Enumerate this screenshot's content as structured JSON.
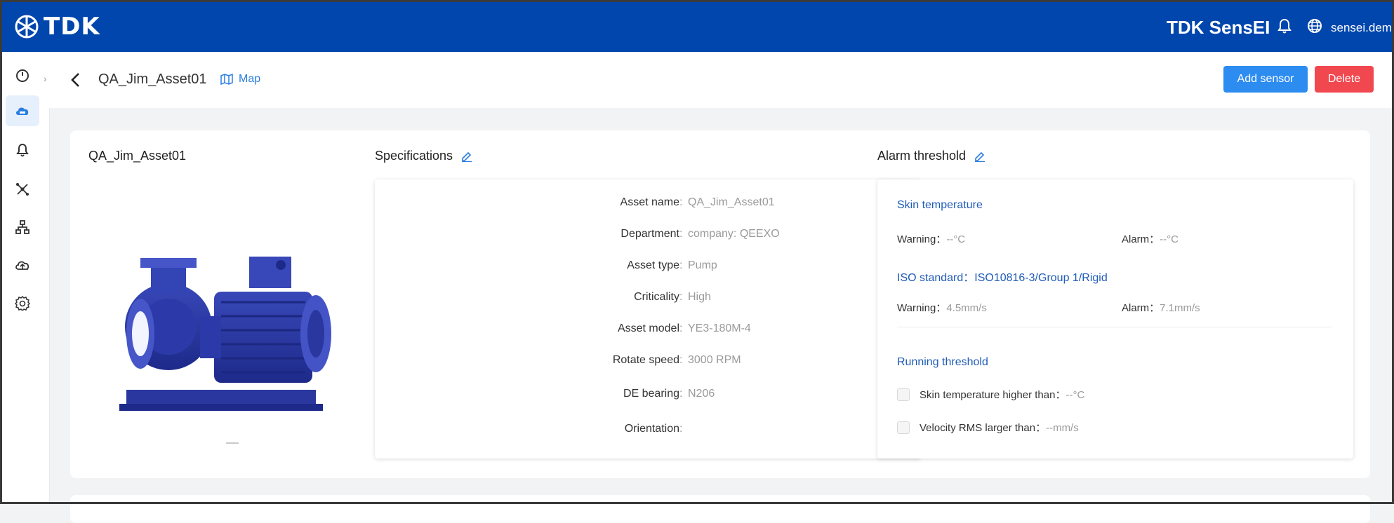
{
  "colors": {
    "brand": "#0046ad",
    "primary": "#2d8cf0",
    "danger": "#f14850",
    "link": "#2a7de1",
    "section_heading": "#1f5bb8"
  },
  "topbar": {
    "logo_text": "TDK",
    "app_title": "TDK SensEI",
    "user": "sensei.demo",
    "bell_icon": "bell-icon",
    "globe_icon": "globe-icon"
  },
  "sidebar": {
    "items": [
      {
        "icon": "dashboard-icon",
        "active": false
      },
      {
        "icon": "asset-cloud-icon",
        "active": true
      },
      {
        "icon": "alert-bell-icon",
        "active": false
      },
      {
        "icon": "network-icon",
        "active": false
      },
      {
        "icon": "hierarchy-icon",
        "active": false
      },
      {
        "icon": "cloud-upload-icon",
        "active": false
      },
      {
        "icon": "settings-gear-icon",
        "active": false
      }
    ]
  },
  "header": {
    "breadcrumb": "QA_Jim_Asset01",
    "map_label": "Map",
    "add_sensor_label": "Add sensor",
    "delete_label": "Delete"
  },
  "asset": {
    "title": "QA_Jim_Asset01"
  },
  "specifications": {
    "title": "Specifications",
    "rows": [
      {
        "label": "Asset name",
        "value": "QA_Jim_Asset01"
      },
      {
        "label": "Department",
        "value": "company: QEEXO"
      },
      {
        "label": "Asset type",
        "value": "Pump"
      },
      {
        "label": "Criticality",
        "value": "High"
      },
      {
        "label": "Asset model",
        "value": "YE3-180M-4"
      },
      {
        "label": "Rotate speed",
        "value": "3000 RPM"
      },
      {
        "label": "DE bearing",
        "value": "N206"
      },
      {
        "label": "Orientation",
        "value": ""
      }
    ]
  },
  "alarm": {
    "title": "Alarm threshold",
    "skin": {
      "heading": "Skin temperature",
      "warning_label": "Warning：",
      "warning_value": "--°C",
      "alarm_label": "Alarm：",
      "alarm_value": "--°C"
    },
    "iso": {
      "heading": "ISO standard：ISO10816-3/Group 1/Rigid",
      "warning_label": "Warning：",
      "warning_value": "4.5mm/s",
      "alarm_label": "Alarm：",
      "alarm_value": "7.1mm/s"
    },
    "running": {
      "heading": "Running threshold",
      "skin_label": "Skin temperature higher than：",
      "skin_value": "--°C",
      "velocity_label": "Velocity RMS larger than：",
      "velocity_value": "--mm/s"
    }
  }
}
